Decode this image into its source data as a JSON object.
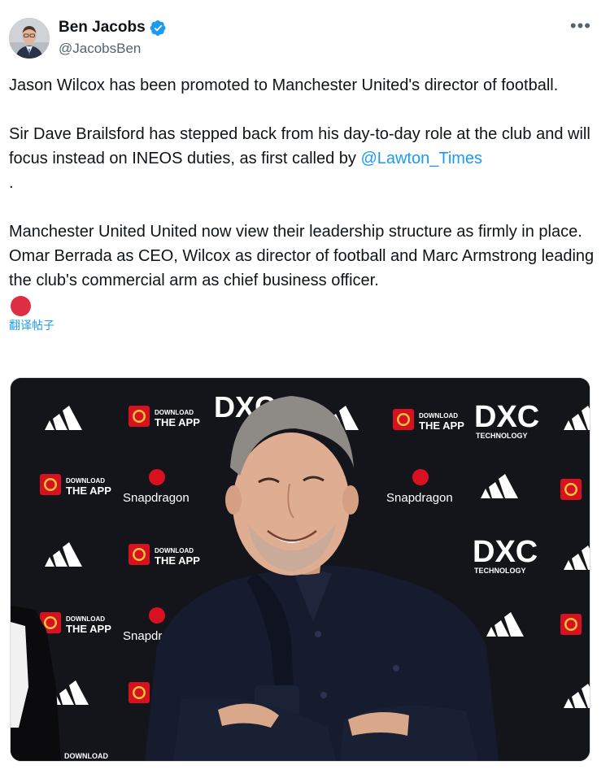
{
  "tweet": {
    "author": {
      "display_name": "Ben Jacobs",
      "handle": "@JacobsBen",
      "verified": true
    },
    "more_label": "•••",
    "paragraph1": "Jason Wilcox has been promoted to Manchester United's director of football.",
    "paragraph2_text": "Sir Dave Brailsford has stepped back from his day-to-day role at the club and will focus instead on INEOS duties, as first called by ",
    "paragraph2_mention": "@Lawton_Times",
    "paragraph2_end": ".",
    "paragraph3": "Manchester United United now view their leadership structure as firmly in place. Omar Berrada as CEO, Wilcox as director of football and Marc Armstrong leading the club's commercial arm as chief business officer.",
    "emoji": "red-circle",
    "translate_label": "翻译帖子"
  },
  "media": {
    "sponsor_labels": {
      "download": "DOWNLOAD",
      "the_app": "THE APP",
      "snapdragon": "Snapdragon",
      "dxc": "DXC",
      "technology": "TECHNOLOGY"
    }
  },
  "colors": {
    "accent": "#1d9bf0",
    "text": "#0f1419",
    "secondary": "#536471",
    "backdrop": "#14151b",
    "united_red": "#d7111f"
  }
}
